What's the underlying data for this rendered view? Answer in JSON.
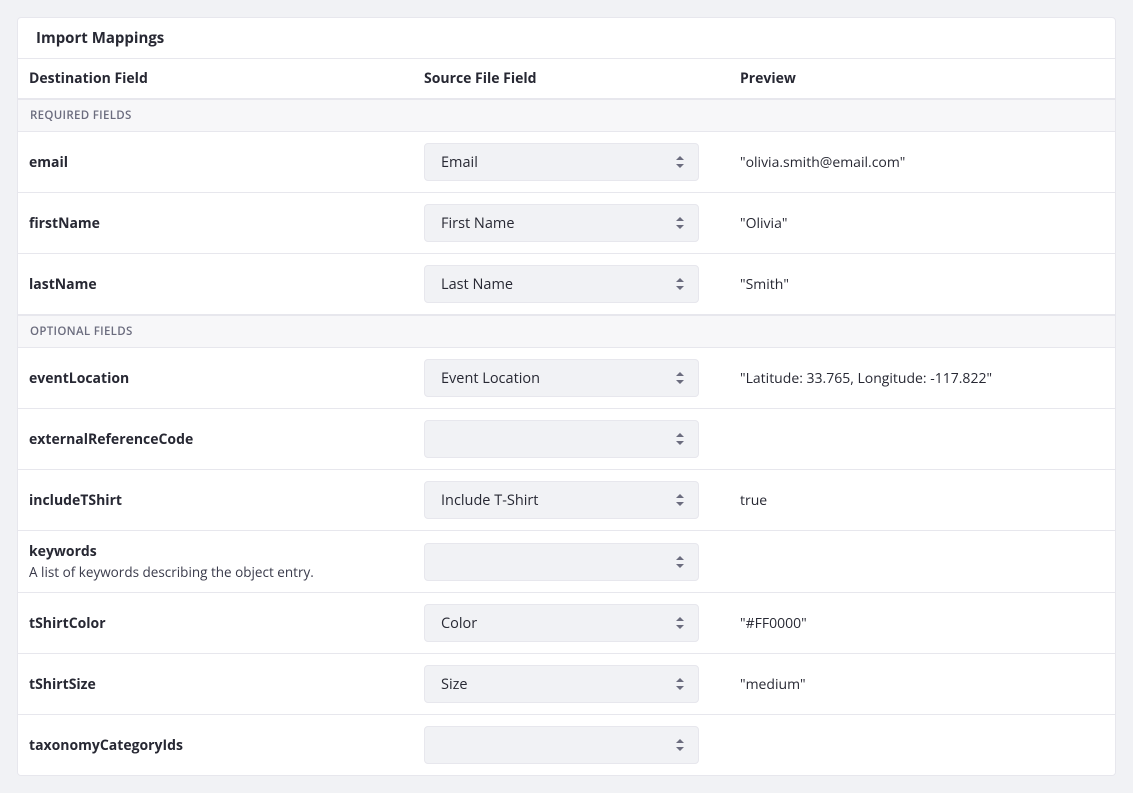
{
  "panel": {
    "title": "Import Mappings"
  },
  "columns": {
    "destination": "Destination Field",
    "source": "Source File Field",
    "preview": "Preview"
  },
  "sections": {
    "0": {
      "title": "REQUIRED FIELDS"
    },
    "1": {
      "title": "OPTIONAL FIELDS"
    }
  },
  "rows": {
    "email": {
      "dest": "email",
      "src": "Email",
      "preview": "\"olivia.smith@email.com\""
    },
    "first": {
      "dest": "firstName",
      "src": "First Name",
      "preview": "\"Olivia\""
    },
    "last": {
      "dest": "lastName",
      "src": "Last Name",
      "preview": "\"Smith\""
    },
    "eventloc": {
      "dest": "eventLocation",
      "src": "Event Location",
      "preview": "\"Latitude: 33.765, Longitude: -117.822\""
    },
    "extref": {
      "dest": "externalReferenceCode",
      "src": "",
      "preview": ""
    },
    "tshirt": {
      "dest": "includeTShirt",
      "src": "Include T-Shirt",
      "preview": "true"
    },
    "keywords": {
      "dest": "keywords",
      "desc": "A list of keywords describing the object entry.",
      "src": "",
      "preview": ""
    },
    "color": {
      "dest": "tShirtColor",
      "src": "Color",
      "preview": "\"#FF0000\""
    },
    "size": {
      "dest": "tShirtSize",
      "src": "Size",
      "preview": "\"medium\""
    },
    "taxonomy": {
      "dest": "taxonomyCategoryIds",
      "src": "",
      "preview": ""
    }
  }
}
